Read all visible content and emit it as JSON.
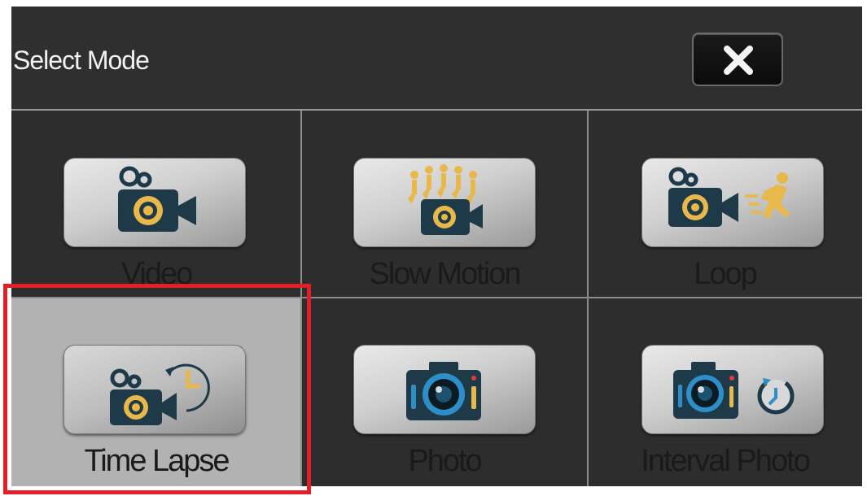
{
  "header": {
    "title": "Select Mode",
    "close_icon": "close-icon"
  },
  "modes": [
    {
      "label": "Video",
      "icon": "video-camera-icon",
      "selected": false
    },
    {
      "label": "Slow Motion",
      "icon": "slow-motion-icon",
      "selected": false
    },
    {
      "label": "Loop",
      "icon": "loop-icon",
      "selected": false
    },
    {
      "label": "Time Lapse",
      "icon": "time-lapse-icon",
      "selected": true
    },
    {
      "label": "Photo",
      "icon": "photo-camera-icon",
      "selected": false
    },
    {
      "label": "Interval Photo",
      "icon": "interval-photo-icon",
      "selected": false
    }
  ],
  "colors": {
    "background": "#2d2d2d",
    "selected_cell": "#b2b2b2",
    "highlight_border": "#e21f26",
    "icon_dark": "#1e3a48",
    "icon_gold": "#e8b84a"
  }
}
